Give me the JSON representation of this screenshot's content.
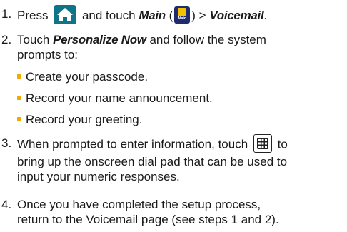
{
  "steps": [
    {
      "number": "1.",
      "pre": "Press",
      "mid": "and touch",
      "main_label": "Main",
      "paren_open": "(",
      "paren_close": ") >",
      "voicemail_label": "Voicemail",
      "period": ".",
      "main_icon_caption": "Main"
    },
    {
      "number": "2.",
      "pre": "Touch",
      "emphasis": "Personalize Now",
      "post": "and follow the system",
      "line2": "prompts to:",
      "bullets": [
        "Create your passcode.",
        "Record your name announcement.",
        "Record your greeting."
      ]
    },
    {
      "number": "3.",
      "line1_pre": "When prompted to enter information, touch",
      "line1_post": "to",
      "line2": "bring up the onscreen dial pad that can be used to",
      "line3": "input your numeric responses."
    },
    {
      "number": "4.",
      "line1": "Once you have completed the setup process,",
      "line2": "return to the Voicemail page (see steps 1 and 2)."
    }
  ],
  "colors": {
    "text": "#1a1a1a",
    "bullet": "#f2a900",
    "home_icon_bg": "#0f7488",
    "main_icon_bg": "#1f2b6e"
  },
  "icons": {
    "home": "home-icon",
    "main": "main-app-icon",
    "keypad": "keypad-icon"
  }
}
